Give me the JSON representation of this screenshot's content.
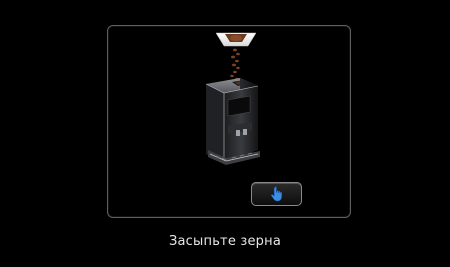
{
  "screen": {
    "message": "Засыпьте зерна"
  },
  "panel": {
    "illustration_icon": "coffee-machine-filling-beans-icon",
    "confirm_button_icon": "hand-pointer-icon"
  },
  "colors": {
    "background": "#000000",
    "panel_border": "#5e5e5e",
    "button_icon": "#3b8ee8",
    "message_text": "#e6e6e6"
  }
}
